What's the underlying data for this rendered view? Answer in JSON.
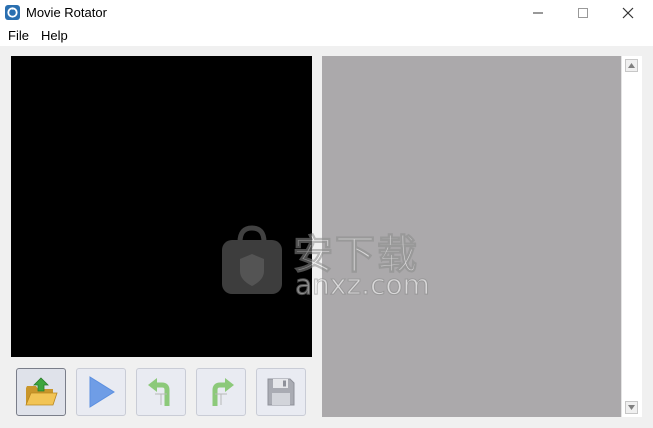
{
  "window": {
    "title": "Movie Rotator"
  },
  "menu": {
    "file": "File",
    "help": "Help"
  },
  "toolbar": [
    {
      "icon": "open-folder-icon"
    },
    {
      "icon": "play-icon"
    },
    {
      "icon": "rotate-left-icon"
    },
    {
      "icon": "rotate-right-icon"
    },
    {
      "icon": "save-icon"
    }
  ],
  "watermark": {
    "chinese": "安下载",
    "url": "anxz.com"
  },
  "colors": {
    "preview": "#000000",
    "list_panel": "#aba9ab",
    "client_bg": "#f0f0f0",
    "accent_play": "#5b8fe0",
    "accent_rotate": "#5aa94b"
  }
}
